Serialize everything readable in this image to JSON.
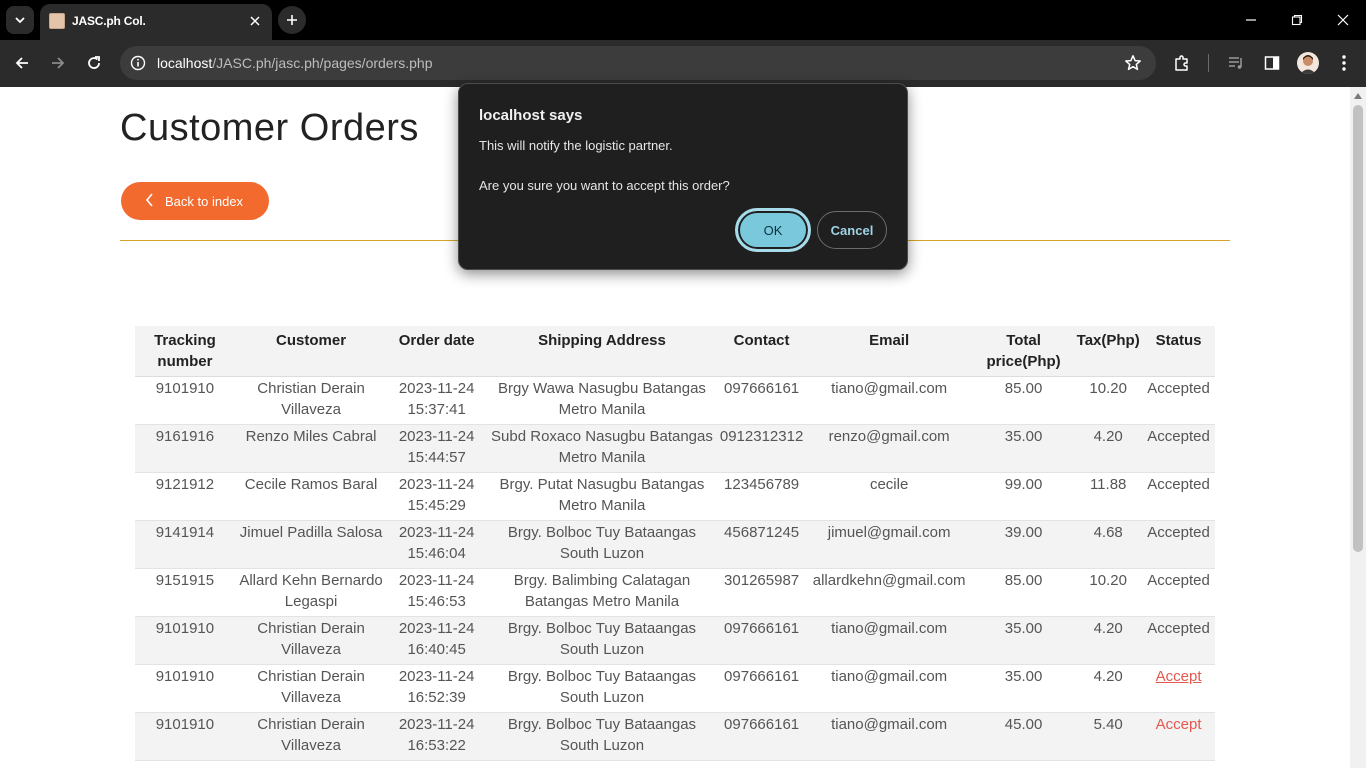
{
  "browser": {
    "tab_title": "JASC.ph Col.",
    "url_host": "localhost",
    "url_path": "/JASC.ph/jasc.ph/pages/orders.php"
  },
  "page": {
    "title": "Customer Orders",
    "back_button": "Back to index"
  },
  "table": {
    "headers": [
      "Tracking number",
      "Customer",
      "Order date",
      "Shipping Address",
      "Contact",
      "Email",
      "Total price(Php)",
      "Tax(Php)",
      "Status"
    ],
    "rows": [
      {
        "tracking": "9101910",
        "customer": "Christian Derain Villaveza",
        "date": "2023-11-24 15:37:41",
        "address": "Brgy Wawa Nasugbu Batangas Metro Manila",
        "contact": "097666161",
        "email": "tiano@gmail.com",
        "total": "85.00",
        "tax": "10.20",
        "status": "Accepted"
      },
      {
        "tracking": "9161916",
        "customer": "Renzo Miles Cabral",
        "date": "2023-11-24 15:44:57",
        "address": "Subd Roxaco Nasugbu Batangas Metro Manila",
        "contact": "0912312312",
        "email": "renzo@gmail.com",
        "total": "35.00",
        "tax": "4.20",
        "status": "Accepted"
      },
      {
        "tracking": "9121912",
        "customer": "Cecile Ramos Baral",
        "date": "2023-11-24 15:45:29",
        "address": "Brgy. Putat Nasugbu Batangas Metro Manila",
        "contact": "123456789",
        "email": "cecile",
        "total": "99.00",
        "tax": "11.88",
        "status": "Accepted"
      },
      {
        "tracking": "9141914",
        "customer": "Jimuel Padilla Salosa",
        "date": "2023-11-24 15:46:04",
        "address": "Brgy. Bolboc Tuy Bataangas South Luzon",
        "contact": "456871245",
        "email": "jimuel@gmail.com",
        "total": "39.00",
        "tax": "4.68",
        "status": "Accepted"
      },
      {
        "tracking": "9151915",
        "customer": "Allard Kehn Bernardo Legaspi",
        "date": "2023-11-24 15:46:53",
        "address": "Brgy. Balimbing Calatagan Batangas Metro Manila",
        "contact": "301265987",
        "email": "allardkehn@gmail.com",
        "total": "85.00",
        "tax": "10.20",
        "status": "Accepted"
      },
      {
        "tracking": "9101910",
        "customer": "Christian Derain Villaveza",
        "date": "2023-11-24 16:40:45",
        "address": "Brgy. Bolboc Tuy Bataangas South Luzon",
        "contact": "097666161",
        "email": "tiano@gmail.com",
        "total": "35.00",
        "tax": "4.20",
        "status": "Accepted"
      },
      {
        "tracking": "9101910",
        "customer": "Christian Derain Villaveza",
        "date": "2023-11-24 16:52:39",
        "address": "Brgy. Bolboc Tuy Bataangas South Luzon",
        "contact": "097666161",
        "email": "tiano@gmail.com",
        "total": "35.00",
        "tax": "4.20",
        "status": "Accept"
      },
      {
        "tracking": "9101910",
        "customer": "Christian Derain Villaveza",
        "date": "2023-11-24 16:53:22",
        "address": "Brgy. Bolboc Tuy Bataangas South Luzon",
        "contact": "097666161",
        "email": "tiano@gmail.com",
        "total": "45.00",
        "tax": "5.40",
        "status": "Accept"
      }
    ]
  },
  "dialog": {
    "title": "localhost says",
    "message_line1": "This will notify the logistic partner.",
    "message_line2": "Are you sure you want to accept this order?",
    "ok_label": "OK",
    "cancel_label": "Cancel"
  },
  "colors": {
    "accent_orange": "#f26a2e",
    "divider_gold": "#d4a52a",
    "accept_link_red": "#e5584e",
    "dialog_ok_blue": "#79c8dc"
  }
}
